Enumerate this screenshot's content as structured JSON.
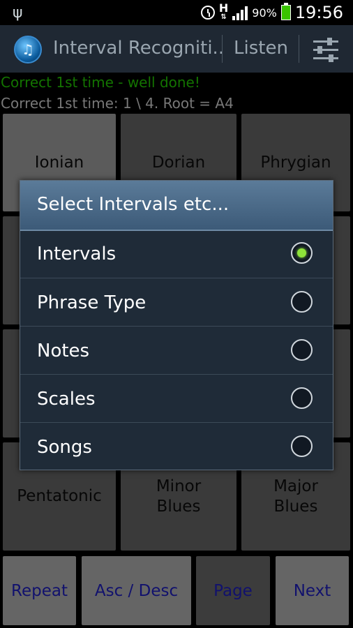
{
  "status": {
    "battery": "90%",
    "network": "H",
    "time": "19:56"
  },
  "actionbar": {
    "title": "Interval Recogniti..",
    "listen": "Listen"
  },
  "messages": {
    "feedback": "Correct 1st time - well done!",
    "score": "Correct 1st time: 1 \\ 4.  Root = A4"
  },
  "grid": {
    "r1": [
      "Ionian",
      "Dorian",
      "Phrygian"
    ],
    "r4": [
      "Pentatonic",
      "Minor\nBlues",
      "Major\nBlues"
    ]
  },
  "bottom": {
    "repeat": "Repeat",
    "ascdesc": "Asc / Desc",
    "page": "Page",
    "next": "Next"
  },
  "dialog": {
    "title": "Select Intervals etc...",
    "options": [
      "Intervals",
      "Phrase Type",
      "Notes",
      "Scales",
      "Songs"
    ],
    "selected": "Intervals"
  },
  "colors": {
    "accent_green": "#1eb100",
    "radio_on": "#8ee33a",
    "bottom_text": "#1b1ba8"
  }
}
